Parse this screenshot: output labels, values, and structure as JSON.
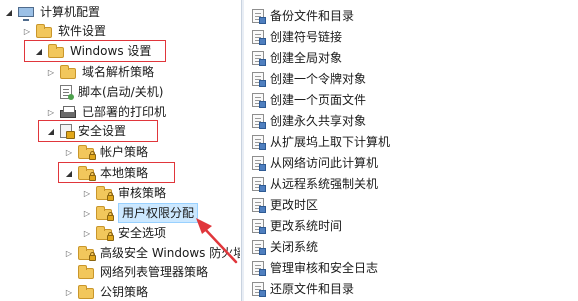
{
  "tree": {
    "root": "计算机配置",
    "software_settings": "软件设置",
    "windows_settings": "Windows 设置",
    "name_resolution_policy": "域名解析策略",
    "scripts": "脚本(启动/关机)",
    "deployed_printers": "已部署的打印机",
    "security_settings": "安全设置",
    "account_policies": "帐户策略",
    "local_policies": "本地策略",
    "audit_policy": "审核策略",
    "user_rights_assignment": "用户权限分配",
    "security_options": "安全选项",
    "advanced_firewall": "高级安全 Windows 防火墙",
    "network_list_manager": "网络列表管理器策略",
    "public_key_policies": "公钥策略"
  },
  "policies": [
    "备份文件和目录",
    "创建符号链接",
    "创建全局对象",
    "创建一个令牌对象",
    "创建一个页面文件",
    "创建永久共享对象",
    "从扩展坞上取下计算机",
    "从网络访问此计算机",
    "从远程系统强制关机",
    "更改时区",
    "更改系统时间",
    "关闭系统",
    "管理审核和安全日志",
    "还原文件和目录"
  ],
  "colors": {
    "highlight_box": "#e0363b",
    "selection_bg": "#cce8ff"
  }
}
